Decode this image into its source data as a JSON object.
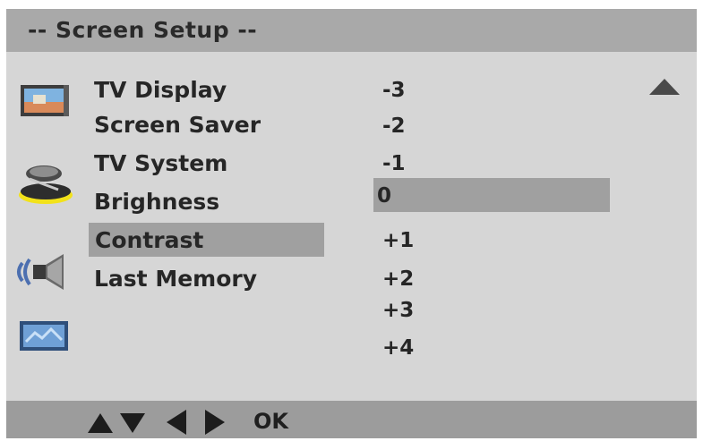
{
  "header": {
    "title": "-- Screen Setup --"
  },
  "menu": {
    "items": [
      {
        "label": "TV Display"
      },
      {
        "label": "Screen Saver"
      },
      {
        "label": "TV System"
      },
      {
        "label": "Brighness"
      },
      {
        "label": "Contrast"
      },
      {
        "label": "Last Memory"
      }
    ],
    "selected": "Contrast"
  },
  "values": {
    "options": [
      "-3",
      "-2",
      "-1",
      "0",
      "+1",
      "+2",
      "+3",
      "+4"
    ],
    "selected": "0"
  },
  "footer": {
    "ok_label": "OK"
  },
  "icons": [
    "tv-display-icon",
    "disc-setup-icon",
    "speaker-audio-icon",
    "screen-icon",
    "scroll-up-arrow-icon",
    "up-arrow-icon",
    "down-arrow-icon",
    "left-arrow-icon",
    "right-arrow-icon"
  ]
}
